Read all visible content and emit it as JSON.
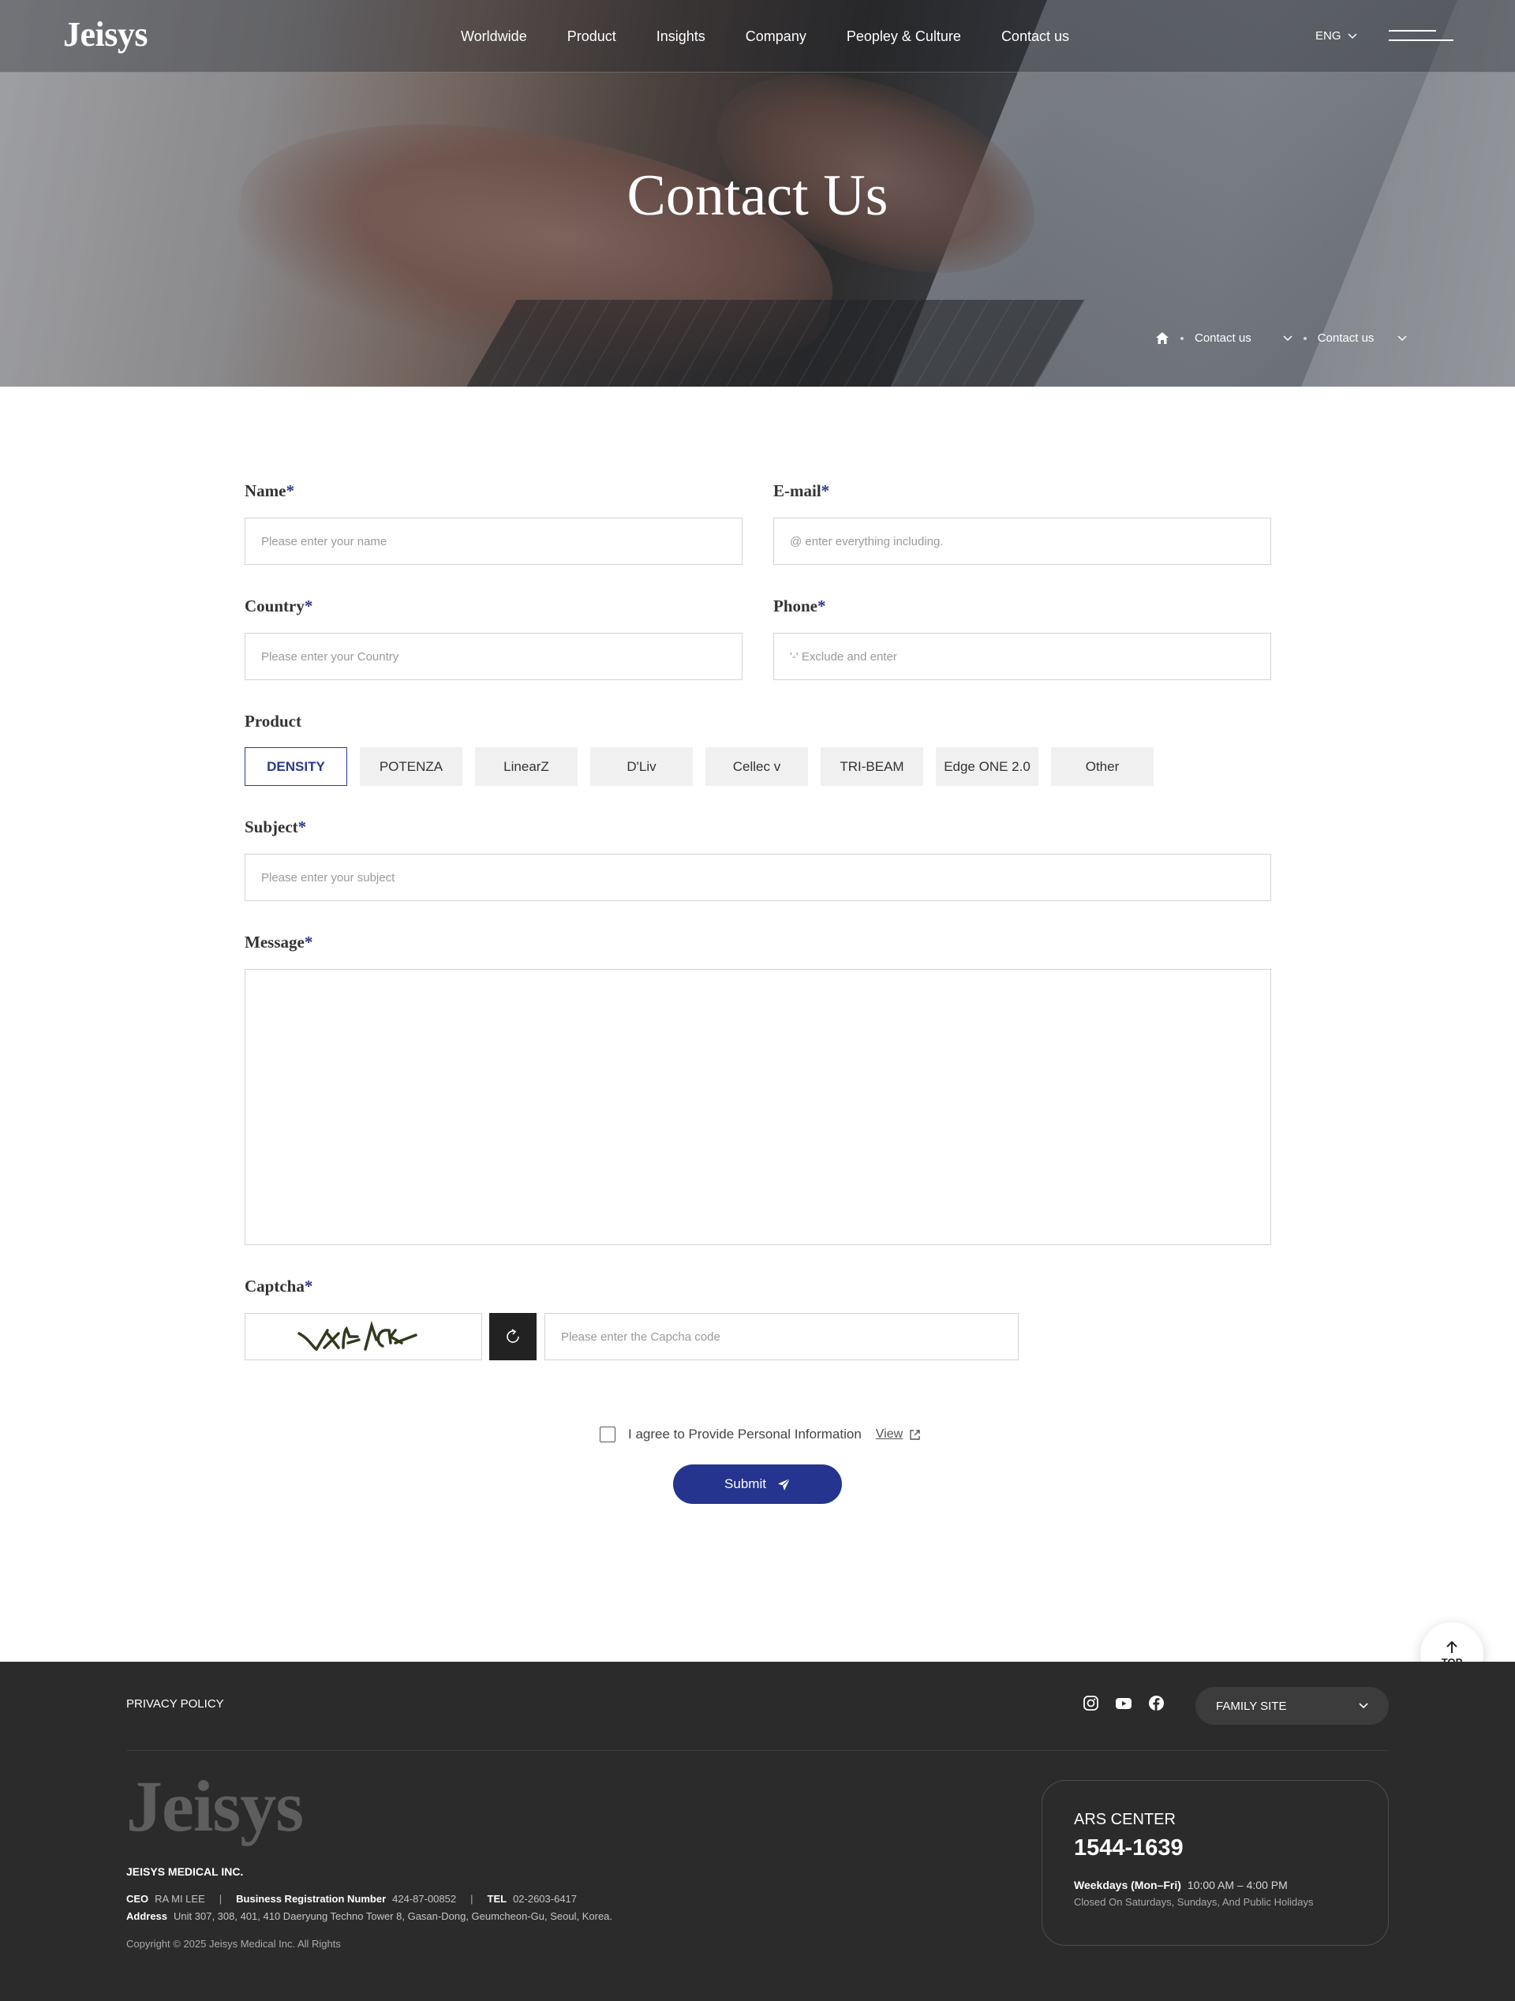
{
  "brand": {
    "logo": "Jeisys",
    "accent": "#2b3990"
  },
  "nav": {
    "items": [
      "Worldwide",
      "Product",
      "Insights",
      "Company",
      "Peopley & Culture",
      "Contact us"
    ],
    "lang": "ENG"
  },
  "hero": {
    "title": "Contact Us",
    "breadcrumb": [
      "Contact us",
      "Contact us"
    ]
  },
  "form": {
    "name": {
      "label": "Name",
      "required": "*",
      "placeholder": "Please enter your name"
    },
    "email": {
      "label": "E-mail",
      "required": "*",
      "placeholder": "@ enter everything including."
    },
    "country": {
      "label": "Country",
      "required": "*",
      "placeholder": "Please enter your Country"
    },
    "phone": {
      "label": "Phone",
      "required": "*",
      "placeholder": "'-' Exclude and enter"
    },
    "product": {
      "label": "Product",
      "selected": "DENSITY",
      "options": [
        "DENSITY",
        "POTENZA",
        "LinearZ",
        "D'Liv",
        "Cellec v",
        "TRI-BEAM",
        "Edge ONE 2.0",
        "Other"
      ]
    },
    "subject": {
      "label": "Subject",
      "required": "*",
      "placeholder": "Please enter your subject"
    },
    "message": {
      "label": "Message",
      "required": "*"
    },
    "captcha": {
      "label": "Captcha",
      "required": "*",
      "image_text": "VXHVCK",
      "placeholder": "Please enter the Capcha code"
    },
    "agree": {
      "text": "I agree to Provide Personal Information",
      "link": "View"
    },
    "submit": "Submit"
  },
  "top_button": "TOP",
  "footer": {
    "privacy": "PRIVACY POLICY",
    "family_site": "FAMILY SITE",
    "logo": "Jeisys",
    "company": "JEISYS MEDICAL INC.",
    "ceo_label": "CEO",
    "ceo": "RA MI LEE",
    "brn_label": "Business Registration Number",
    "brn": "424-87-00852",
    "tel_label": "TEL",
    "tel": "02-2603-6417",
    "address_label": "Address",
    "address": "Unit 307, 308, 401, 410 Daeryung Techno Tower 8, Gasan-Dong, Geumcheon-Gu, Seoul, Korea.",
    "copyright": "Copyright © 2025 Jeisys Medical Inc. All Rights",
    "ars": {
      "title": "ARS CENTER",
      "number": "1544-1639",
      "hours_label": "Weekdays (Mon–Fri)",
      "hours": "10:00 AM – 4:00 PM",
      "closed": "Closed On Saturdays, Sundays, And Public Holidays"
    },
    "social_icons": [
      "instagram-icon",
      "youtube-icon",
      "facebook-icon"
    ]
  }
}
